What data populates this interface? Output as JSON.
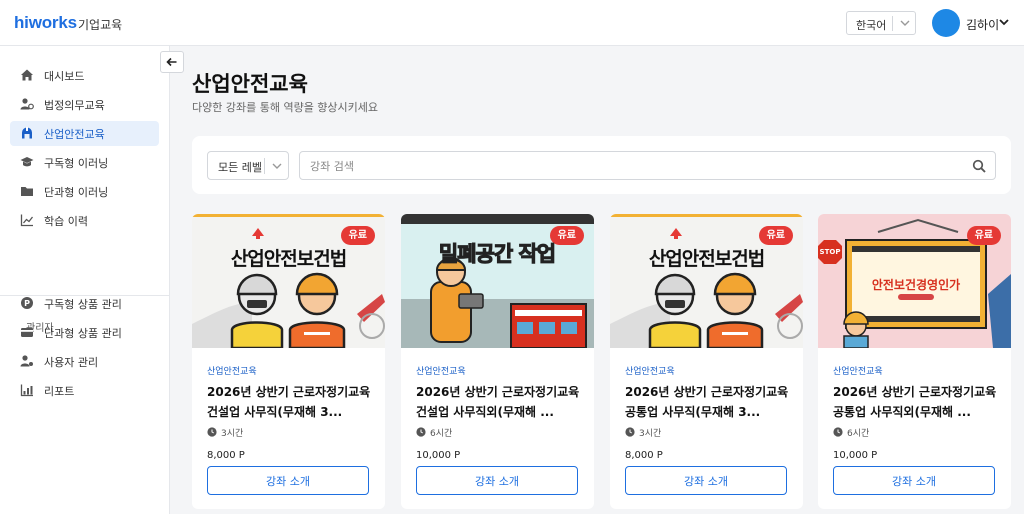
{
  "header": {
    "logo": "hiworks",
    "logo_sub": "기업교육",
    "language": "한국어",
    "user_name": "김하이"
  },
  "sidebar": {
    "items": [
      {
        "label": "대시보드",
        "icon": "home-icon"
      },
      {
        "label": "법정의무교육",
        "icon": "users-icon"
      },
      {
        "label": "산업안전교육",
        "icon": "helmet-icon",
        "active": true
      },
      {
        "label": "구독형 이러닝",
        "icon": "graduation-cap-icon"
      },
      {
        "label": "단과형 이러닝",
        "icon": "folder-icon"
      },
      {
        "label": "학습 이력",
        "icon": "chart-line-icon"
      }
    ],
    "admin_section_label": "관리자",
    "admin_items": [
      {
        "label": "구독형 상품 관리",
        "icon": "coin-icon"
      },
      {
        "label": "단과형 상품 관리",
        "icon": "card-icon"
      },
      {
        "label": "사용자 관리",
        "icon": "user-settings-icon"
      },
      {
        "label": "리포트",
        "icon": "report-icon"
      }
    ]
  },
  "main": {
    "title": "산업안전교육",
    "subtitle": "다양한 강좌를 통해 역량을 향상시키세요",
    "filter": {
      "level_selected": "모든 레벨",
      "search_placeholder": "강좌 검색"
    },
    "courses": [
      {
        "badge": "유료",
        "thumb_text": "산업안전보건법",
        "category": "산업안전교육",
        "title": "2026년 상반기 근로자정기교육 건설업 사무직(무재해 3...",
        "duration": "3시간",
        "price": "8,000 P",
        "button": "강좌 소개"
      },
      {
        "badge": "유료",
        "thumb_text": "밀폐공간 작업",
        "category": "산업안전교육",
        "title": "2026년 상반기 근로자정기교육 건설업 사무직외(무재해 ...",
        "duration": "6시간",
        "price": "10,000 P",
        "button": "강좌 소개"
      },
      {
        "badge": "유료",
        "thumb_text": "산업안전보건법",
        "category": "산업안전교육",
        "title": "2026년 상반기 근로자정기교육 공통업 사무직(무재해 3...",
        "duration": "3시간",
        "price": "8,000 P",
        "button": "강좌 소개"
      },
      {
        "badge": "유료",
        "thumb_text": "안전보건경영인가",
        "thumb_sign": "STOP",
        "category": "산업안전교육",
        "title": "2026년 상반기 근로자정기교육 공통업 사무직외(무재해 ...",
        "duration": "6시간",
        "price": "10,000 P",
        "button": "강좌 소개"
      }
    ]
  },
  "colors": {
    "brand": "#1f6fe0",
    "active_bg": "#e7f0fc",
    "badge": "#e53935"
  }
}
